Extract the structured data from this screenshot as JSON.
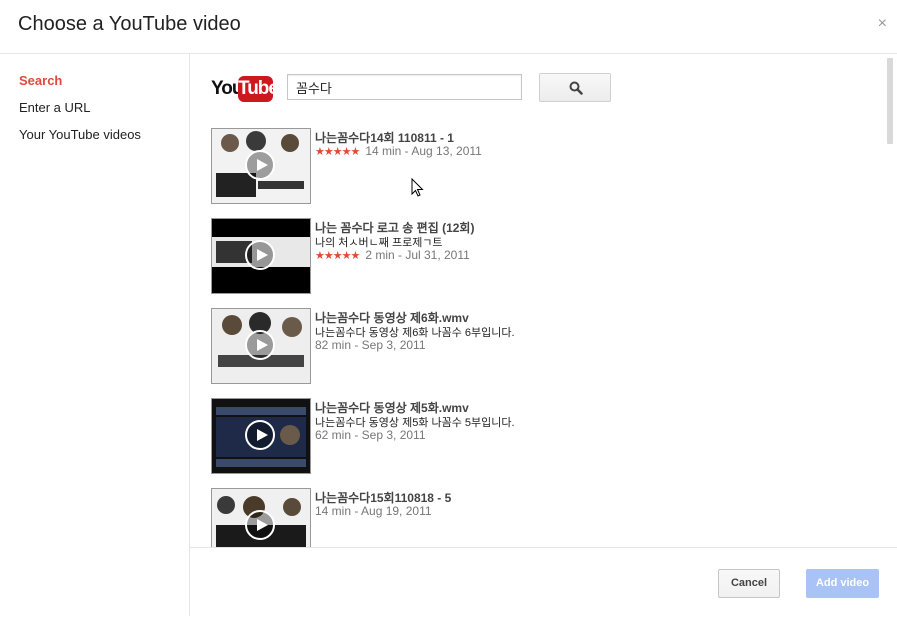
{
  "dialog": {
    "title": "Choose a YouTube video",
    "close_icon": "×"
  },
  "sidebar": {
    "items": [
      {
        "label": "Search",
        "active": true
      },
      {
        "label": "Enter a URL",
        "active": false
      },
      {
        "label": "Your YouTube videos",
        "active": false
      }
    ]
  },
  "search": {
    "logo_you": "You",
    "logo_tube": "Tube",
    "value": "꼼수다",
    "button_icon": "search-icon"
  },
  "results": [
    {
      "title": "나는꼼수다14회 110811 - 1",
      "description": "",
      "rating_stars": 4.5,
      "meta": "14 min - Aug 13, 2011"
    },
    {
      "title": "나는 꼼수다 로고 송 편집 (12회)",
      "description": "나의 처ㅅ버ㄴ째 프로제ㄱ트",
      "rating_stars": 5,
      "meta": "2 min - Jul 31, 2011"
    },
    {
      "title": "나는꼼수다 동영상 제6화.wmv",
      "description": "나는꼼수다 동영상 제6화 나꼼수 6부입니다.",
      "rating_stars": null,
      "meta": "82 min - Sep 3, 2011"
    },
    {
      "title": "나는꼼수다 동영상 제5화.wmv",
      "description": "나는꼼수다 동영상 제5화 나꼼수 5부입니다.",
      "rating_stars": null,
      "meta": "62 min - Sep 3, 2011"
    },
    {
      "title": "나는꼼수다15회110818 - 5",
      "description": "",
      "rating_stars": null,
      "meta": "14 min - Aug 19, 2011"
    }
  ],
  "footer": {
    "cancel_label": "Cancel",
    "add_label": "Add video"
  },
  "colors": {
    "accent": "#dd4b39",
    "add_button_disabled": "#a9c3f6",
    "youtube_red": "#cc181e"
  }
}
